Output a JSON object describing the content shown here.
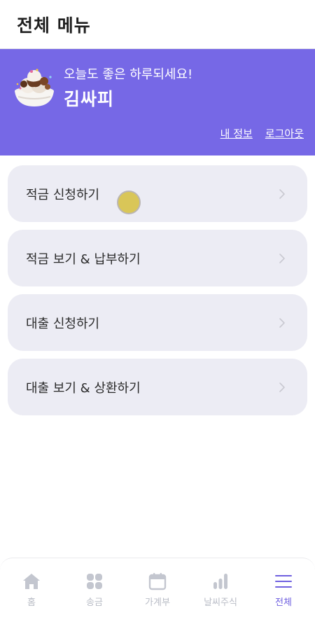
{
  "header": {
    "title": "전체 메뉴"
  },
  "profile": {
    "greeting": "오늘도 좋은 하루되세요!",
    "name": "김싸피",
    "my_info_link": "내 정보",
    "logout_link": "로그아웃"
  },
  "menu": {
    "items": [
      {
        "label": "적금 신청하기"
      },
      {
        "label": "적금 보기 & 납부하기"
      },
      {
        "label": "대출 신청하기"
      },
      {
        "label": "대출 보기 & 상환하기"
      }
    ]
  },
  "nav": {
    "items": [
      {
        "label": "홈",
        "icon": "home-icon"
      },
      {
        "label": "송금",
        "icon": "grid-icon"
      },
      {
        "label": "가계부",
        "icon": "calendar-icon"
      },
      {
        "label": "날씨주식",
        "icon": "bar-chart-icon"
      },
      {
        "label": "전체",
        "icon": "menu-icon",
        "active": true
      }
    ]
  },
  "colors": {
    "accent": "#7668e6",
    "card": "#ececf4",
    "nav_inactive": "#b9bcc6",
    "nav_active": "#6f60e0"
  }
}
